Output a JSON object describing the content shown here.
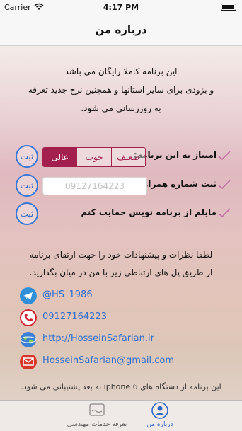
{
  "status": {
    "carrier": "Carrier",
    "time": "4:17 PM"
  },
  "nav": {
    "title": "درباره من"
  },
  "intro": {
    "line1": "این برنامه کاملا رایگان می باشد",
    "line2": "و بزودی برای سایر استانها و همچنین نرخ جدید تعرفه",
    "line3": "به روزرسانی می شود."
  },
  "rating": {
    "label": "امتیاز به این برنامه:",
    "options": [
      "ضعیف",
      "خوب",
      "عالی"
    ],
    "selected": "عالی",
    "button": "ثبت"
  },
  "phone": {
    "label": "ثبت شماره همراه:",
    "placeholder": "09127164223",
    "button": "ثبت"
  },
  "support": {
    "label": "مایلم از برنامه نویس حمایت کنم",
    "button": "ثبت"
  },
  "contact_intro": {
    "line1": "لطفا نظرات و پیشنهادات خود را  جهت ارتقای برنامه",
    "line2": "از طریق پل های ارتباطی زیر با من در میان بگذارید."
  },
  "contacts": [
    {
      "icon": "telegram-icon",
      "text": "@HS_1986",
      "color": "#2f8fd8"
    },
    {
      "icon": "phone-icon",
      "text": "09127164223",
      "color": "#d11f2e"
    },
    {
      "icon": "globe-icon",
      "text": "http://HosseinSafarian.ir",
      "color": "#3b7fd6"
    },
    {
      "icon": "mail-icon",
      "text": "HosseinSafarian@gmail.com",
      "color": "#d9362b"
    }
  ],
  "footer_note": "این برنامه از دستگاه های iphone 6 به بعد پشتیبانی می شود.",
  "tabs": [
    {
      "label": "تعرفه خدمات مهندسی",
      "active": false
    },
    {
      "label": "درباره من",
      "active": true
    }
  ],
  "colors": {
    "accent": "#a21f4e",
    "button_blue": "#2d67c6"
  }
}
